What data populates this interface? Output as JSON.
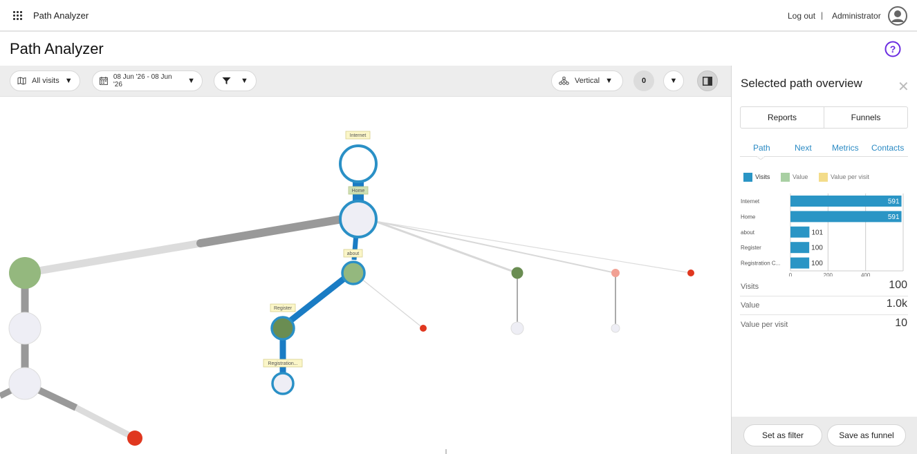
{
  "topbar": {
    "app_name": "Path Analyzer",
    "logout": "Log out",
    "separator": "|",
    "username": "Administrator"
  },
  "page": {
    "title": "Path Analyzer"
  },
  "toolbar": {
    "visits_filter": "All visits",
    "date_range": "08 Jun '26 - 08 Jun '26",
    "orientation": "Vertical",
    "count_badge": "0"
  },
  "graph": {
    "labels": {
      "internet": "Internet",
      "home": "Home",
      "about": "about",
      "register": "Register",
      "registration": "Registration..."
    }
  },
  "panel": {
    "title": "Selected path overview",
    "segments": [
      "Reports",
      "Funnels"
    ],
    "tabs": [
      "Path",
      "Next",
      "Metrics",
      "Contacts"
    ],
    "legend": [
      "Visits",
      "Value",
      "Value per visit"
    ],
    "colors": {
      "visits": "#2a95c5",
      "value": "#a9d0a3",
      "value_per_visit": "#f3dc8a"
    },
    "metrics": [
      {
        "label": "Visits",
        "value": "100"
      },
      {
        "label": "Value",
        "value": "1.0k"
      },
      {
        "label": "Value per visit",
        "value": "10"
      }
    ],
    "footer": {
      "set_filter": "Set as filter",
      "save_funnel": "Save as funnel"
    }
  },
  "chart_data": {
    "type": "bar",
    "orientation": "horizontal",
    "categories": [
      "Internet",
      "Home",
      "about",
      "Register",
      "Registration C..."
    ],
    "series": [
      {
        "name": "Visits",
        "values": [
          591,
          591,
          101,
          100,
          100
        ]
      }
    ],
    "xticks": [
      "0",
      "200",
      "400"
    ],
    "xlim": [
      0,
      600
    ]
  }
}
